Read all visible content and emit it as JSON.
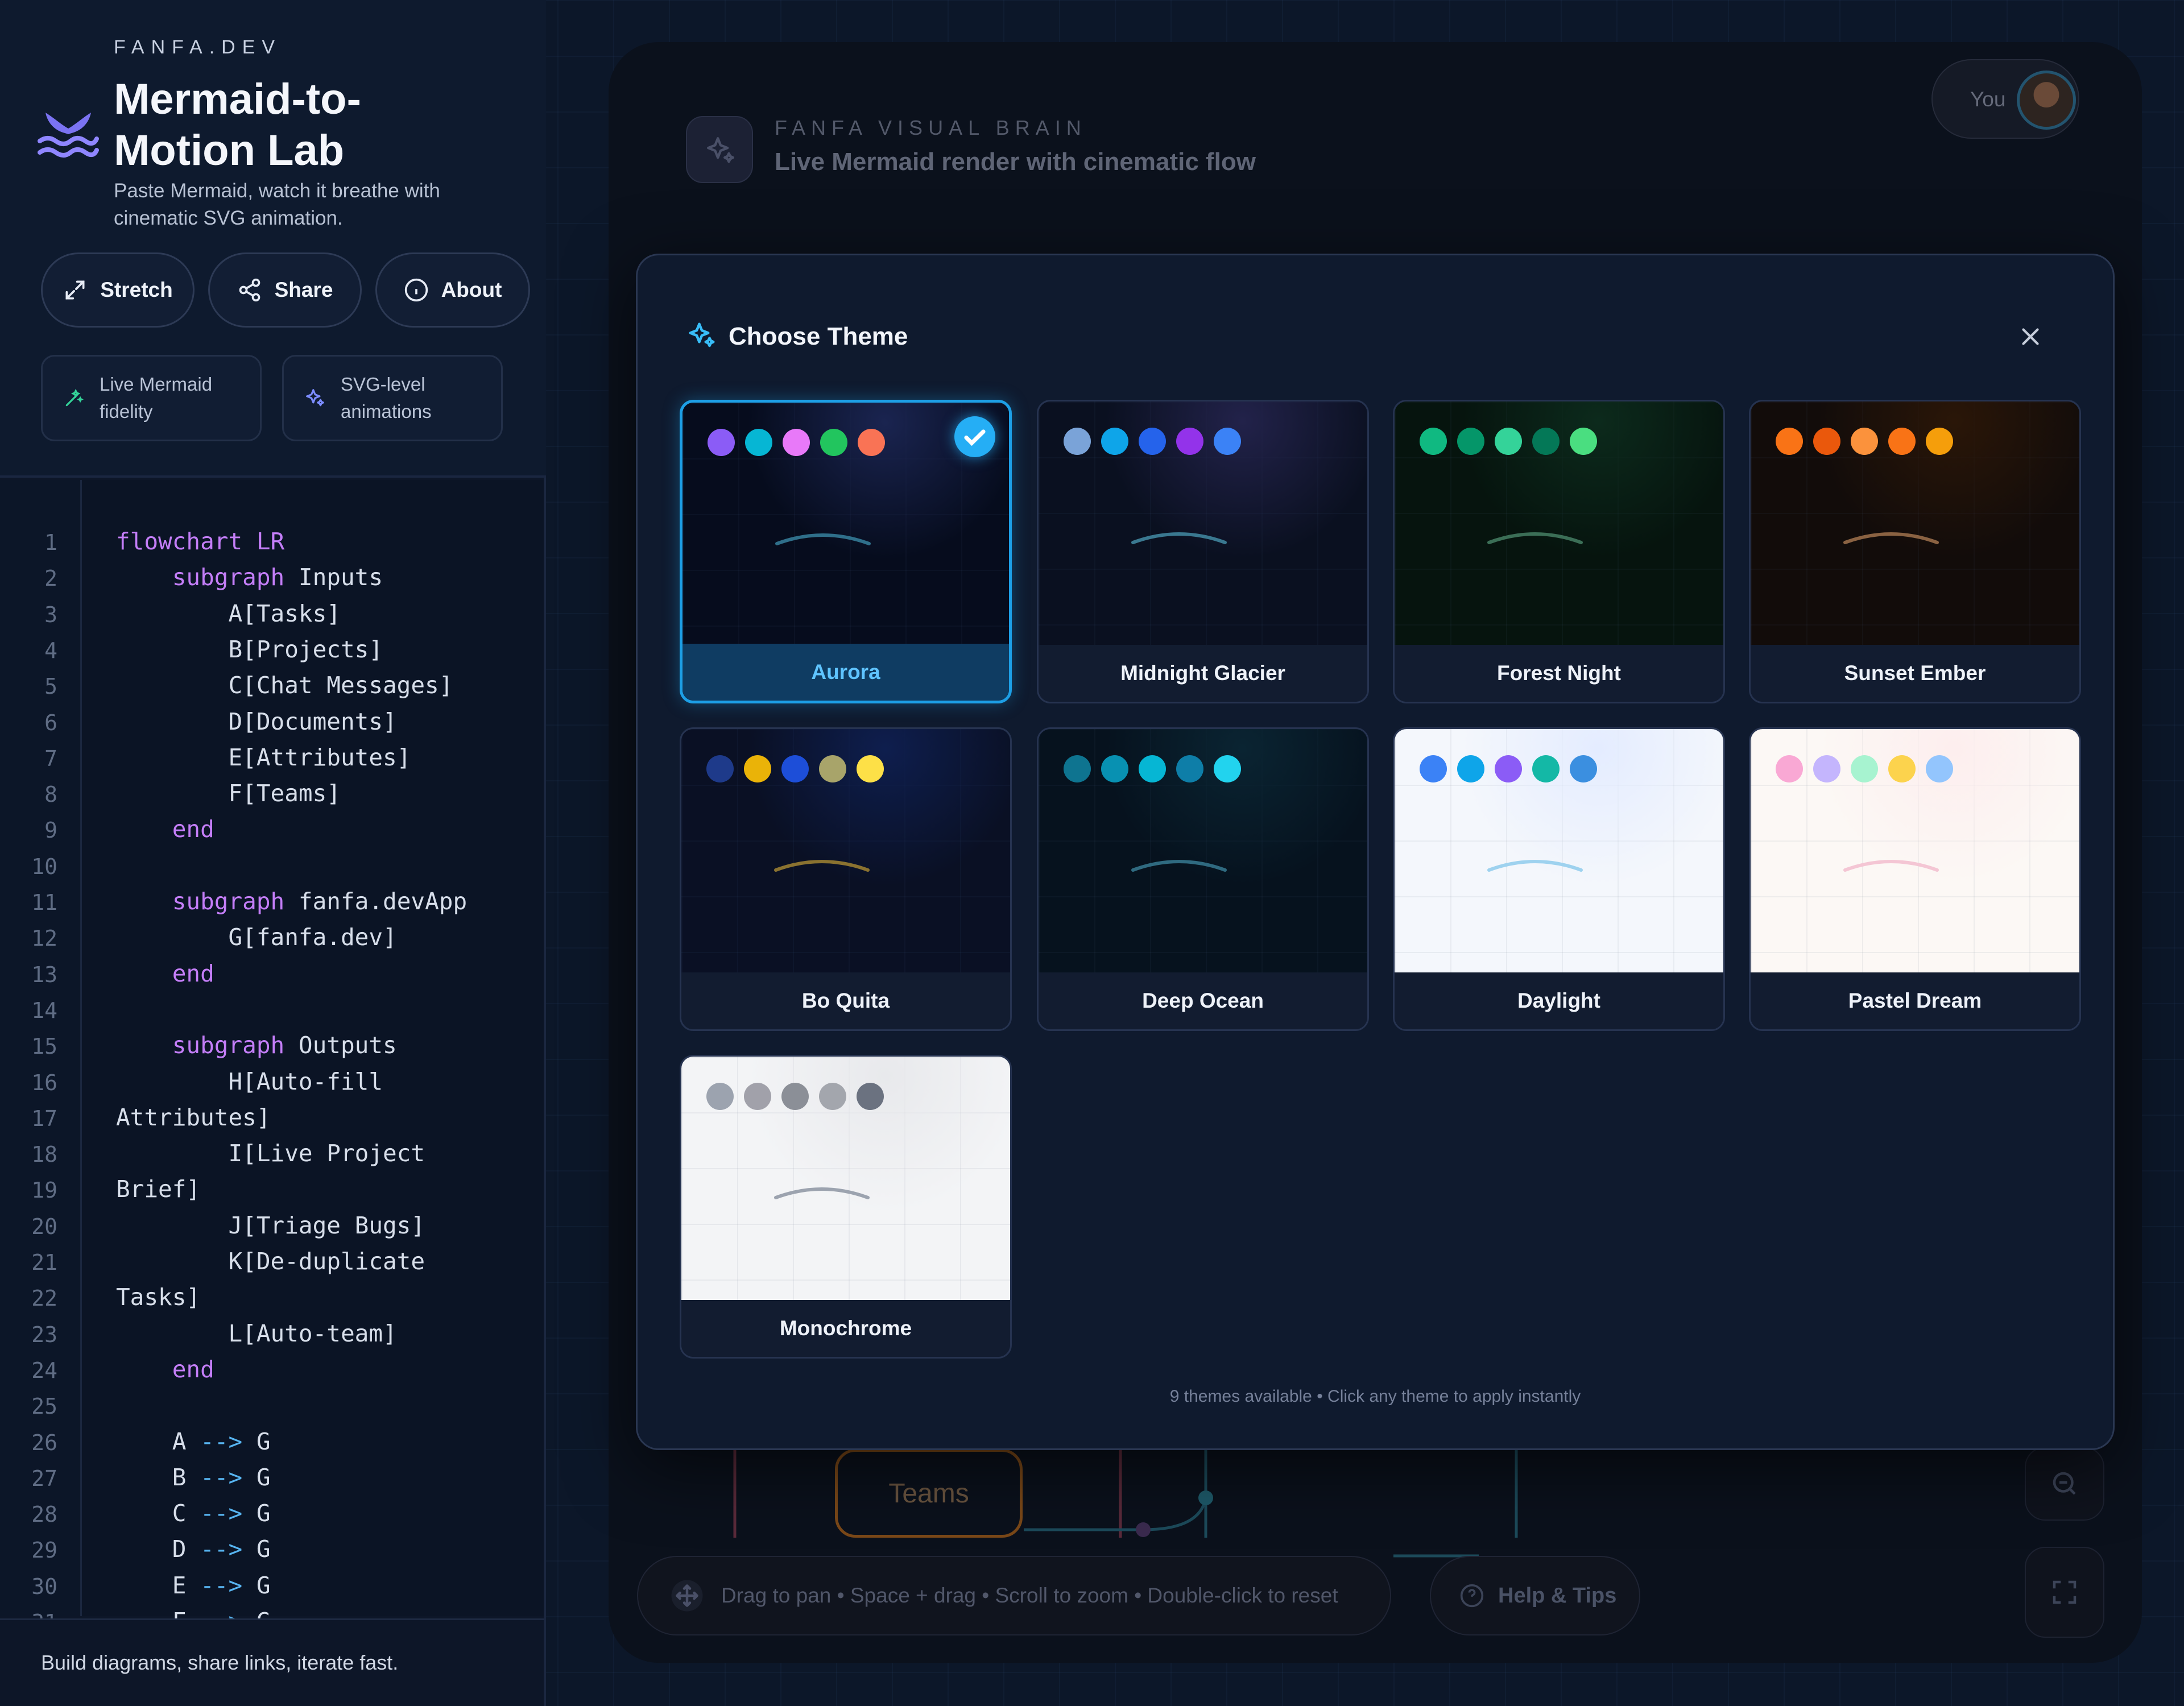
{
  "sidebar": {
    "brand_tag": "FANFA.DEV",
    "title": "Mermaid-to-Motion Lab",
    "subtitle": "Paste Mermaid, watch it breathe with cinematic SVG animation.",
    "buttons": {
      "stretch": "Stretch",
      "share": "Share",
      "about": "About"
    },
    "features": {
      "fidelity": "Live Mermaid fidelity",
      "animations": "SVG-level animations"
    },
    "footer": "Build diagrams, share links, iterate fast."
  },
  "code_lines": [
    "flowchart LR",
    "    subgraph Inputs",
    "        A[Tasks]",
    "        B[Projects]",
    "        C[Chat Messages]",
    "        D[Documents]",
    "        E[Attributes]",
    "        F[Teams]",
    "    end",
    "",
    "    subgraph fanfa.devApp",
    "        G[fanfa.dev]",
    "    end",
    "",
    "    subgraph Outputs",
    "        H[Auto-fill",
    "Attributes]",
    "        I[Live Project",
    "Brief]",
    "        J[Triage Bugs]",
    "        K[De-duplicate",
    "Tasks]",
    "        L[Auto-team]",
    "    end",
    "",
    "    A --> G",
    "    B --> G",
    "    C --> G",
    "    D --> G",
    "    E --> G",
    "    F --> G"
  ],
  "canvas": {
    "tag": "FANFA VISUAL BRAIN",
    "title": "Live Mermaid render with cinematic flow",
    "user_label": "You",
    "node_teams": "Teams",
    "hint": "Drag to pan • Space + drag • Scroll to zoom • Double-click to reset",
    "help": "Help & Tips"
  },
  "modal": {
    "title": "Choose Theme",
    "footer": "9 themes available • Click any theme to apply instantly",
    "selected": "Aurora",
    "themes": [
      {
        "name": "Aurora",
        "bg": "#060c1d",
        "glow": "#1a2450",
        "arc": "#2f6f8a",
        "dots": [
          "#8b5cf6",
          "#06b6d4",
          "#e879f9",
          "#22c55e",
          "#f97355"
        ]
      },
      {
        "name": "Midnight Glacier",
        "bg": "#0a1020",
        "glow": "#22224a",
        "arc": "#3a7890",
        "dots": [
          "#7aa3d8",
          "#0ea5e9",
          "#2563eb",
          "#9333ea",
          "#3b82f6"
        ]
      },
      {
        "name": "Forest Night",
        "bg": "#06140e",
        "glow": "#0c2a1c",
        "arc": "#3b6e56",
        "dots": [
          "#10b981",
          "#059669",
          "#34d399",
          "#047857",
          "#4ade80"
        ]
      },
      {
        "name": "Sunset Ember",
        "bg": "#120c0a",
        "glow": "#2a1608",
        "arc": "#8a6242",
        "dots": [
          "#f97316",
          "#ea580c",
          "#fb923c",
          "#f97316",
          "#f59e0b"
        ]
      },
      {
        "name": "Bo Quita",
        "bg": "#0a1024",
        "glow": "#0e1e4e",
        "arc": "#8a7230",
        "dots": [
          "#1e3a8a",
          "#eab308",
          "#1d4ed8",
          "#a8a46a",
          "#fde047"
        ]
      },
      {
        "name": "Deep Ocean",
        "bg": "#06121e",
        "glow": "#0a2432",
        "arc": "#2f6a80",
        "dots": [
          "#0e7490",
          "#0891b2",
          "#06b6d4",
          "#0e7ea8",
          "#22d3ee"
        ]
      },
      {
        "name": "Daylight",
        "bg": "#f4f7fc",
        "glow": "#e4ecff",
        "arc": "#9ed2ef",
        "dots": [
          "#3b82f6",
          "#0ea5e9",
          "#8b5cf6",
          "#14b8a6",
          "#3b8fe0"
        ]
      },
      {
        "name": "Pastel Dream",
        "bg": "#fcf8f5",
        "glow": "#fdeeee",
        "arc": "#f4c6d4",
        "dots": [
          "#f9a8d4",
          "#c4b5fd",
          "#a7f3d0",
          "#fcd34d",
          "#93c5fd"
        ]
      },
      {
        "name": "Monochrome",
        "bg": "#f3f4f6",
        "glow": "#e8e9ec",
        "arc": "#9ca3af",
        "dots": [
          "#9ca3af",
          "#a1a1aa",
          "#8b8f97",
          "#a3a6ad",
          "#6b7280"
        ]
      }
    ]
  }
}
